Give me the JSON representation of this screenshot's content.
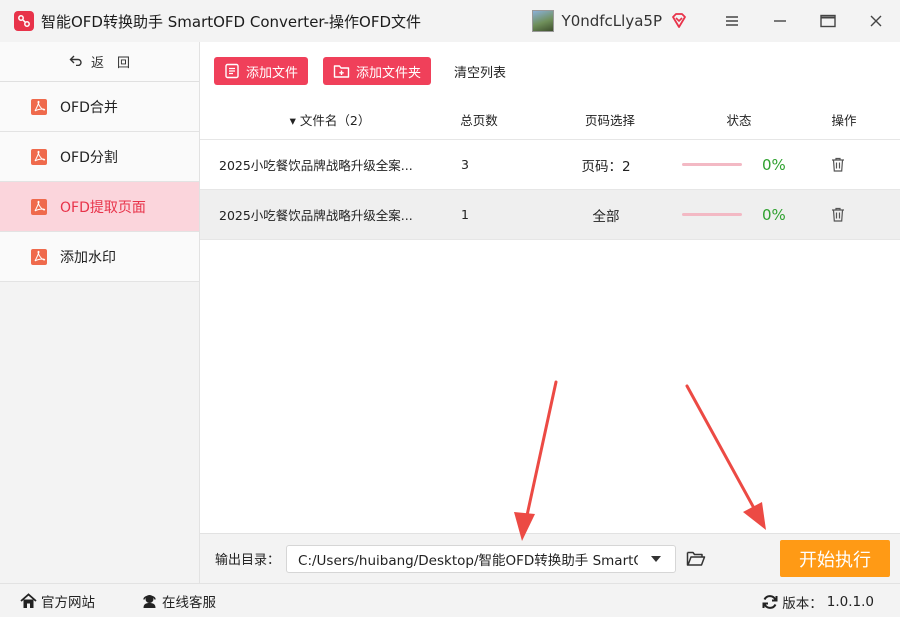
{
  "window": {
    "title": "智能OFD转换助手 SmartOFD Converter-操作OFD文件",
    "username": "Y0ndfcLlya5P",
    "accent": "#e8334a"
  },
  "sidebar": {
    "back_label": "返　回",
    "items": [
      {
        "label": "OFD合并",
        "active": false
      },
      {
        "label": "OFD分割",
        "active": false
      },
      {
        "label": "OFD提取页面",
        "active": true
      },
      {
        "label": "添加水印",
        "active": false
      }
    ]
  },
  "toolbar": {
    "add_file": "添加文件",
    "add_folder": "添加文件夹",
    "clear": "清空列表"
  },
  "table": {
    "headers": {
      "name": "▾ 文件名（2）",
      "pages": "总页数",
      "range": "页码选择",
      "status": "状态",
      "op": "操作"
    },
    "rows": [
      {
        "name": "2025小吃餐饮品牌战略升级全案...",
        "pages": "3",
        "range": "页码：2",
        "progress": "0%"
      },
      {
        "name": "2025小吃餐饮品牌战略升级全案...",
        "pages": "1",
        "range": "全部",
        "progress": "0%"
      }
    ]
  },
  "output": {
    "label": "输出目录：",
    "path": "C:/Users/huibang/Desktop/智能OFD转换助手 SmartOFD Converter",
    "start": "开始执行"
  },
  "footer": {
    "site": "官方网站",
    "service": "在线客服",
    "version_label": "版本：",
    "version": "1.0.1.0"
  },
  "colors": {
    "primary_button": "#f0405a",
    "start_button": "#ff9a15",
    "active_nav_bg": "#fbd5dc",
    "progress_text": "#2fa12f"
  }
}
